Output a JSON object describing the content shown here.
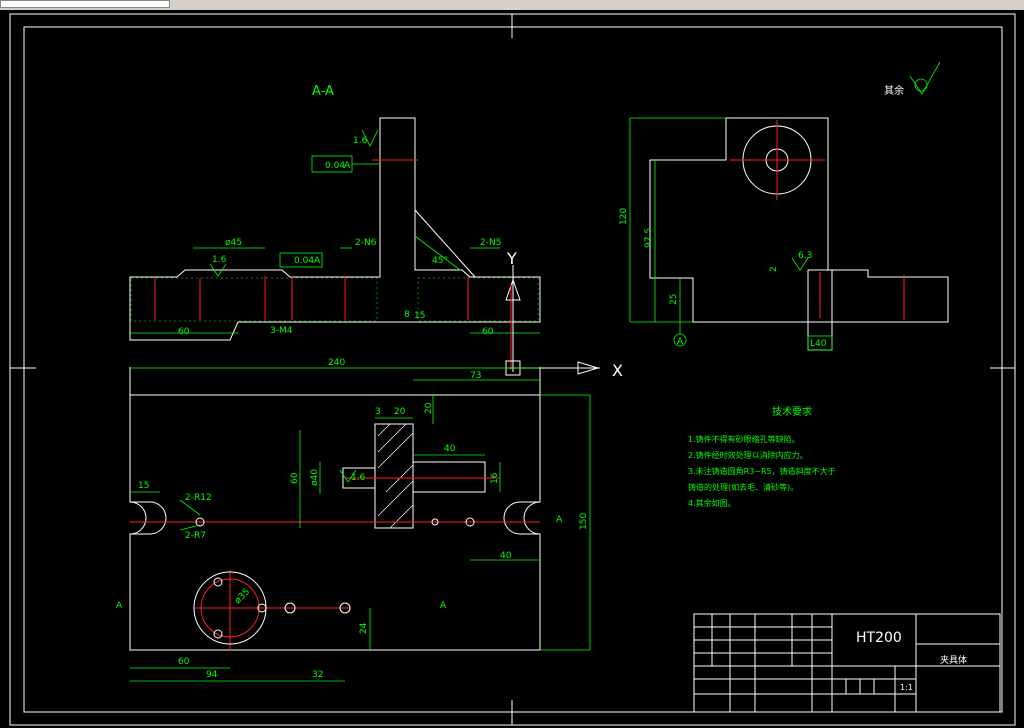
{
  "section_label": "A-A",
  "finish_label": "其余",
  "surface_finish": [
    "1.6",
    "1.6",
    "1.6",
    "1.6",
    "6.3"
  ],
  "tolerances": {
    "perp": "0.04",
    "perp_datum": "A",
    "parallel": "0.04",
    "parallel_datum": "A"
  },
  "dims_top": {
    "d45": "ø45",
    "n6": "2-N6",
    "n5": "2-N5",
    "angle": "45°",
    "left60": "60",
    "right60": "60",
    "m4": "3-M4",
    "b8": "8",
    "b15": "15"
  },
  "dims_right": {
    "h120": "120",
    "h97": "97.5",
    "h25": "25",
    "h2": "2",
    "datum": "A",
    "lw": "L40"
  },
  "axis": {
    "y": "Y",
    "x": "X"
  },
  "dims_plan": {
    "d240": "240",
    "d73": "73",
    "d20a": "20",
    "d20b": "20",
    "d3": "3",
    "d40a": "40",
    "d60": "60",
    "d40b": "ø40",
    "d16a": "16",
    "d16b": "1.6",
    "d15": "15",
    "r12": "2-R12",
    "r7": "2-R7",
    "d40c": "40",
    "d150": "150",
    "d35": "ø35",
    "d24": "24",
    "b60": "60",
    "b94": "94",
    "b32": "32",
    "sectA1": "A",
    "sectA2": "A",
    "sectA3": "A"
  },
  "tech_title": "技术要求",
  "tech_notes": [
    "1.铸件不得有砂眼缩孔等缺陷。",
    "2.铸件经时效处理以消除内应力。",
    "3.未注铸造圆角R3~R5，铸造斜度不大于",
    "铸造的处理(如去毛、清砂等)。",
    "4.其余如图。"
  ],
  "title_block": {
    "material": "HT200",
    "name": "夹具体",
    "scale": "1:1"
  }
}
